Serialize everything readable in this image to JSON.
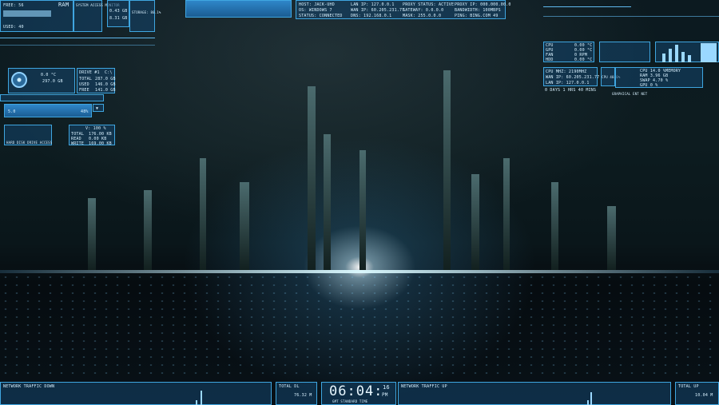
{
  "top_left": {
    "free_ram_label": "FREE: 56",
    "ram_label": "RAM",
    "used_label": "USED: 40",
    "panel2_title": "SYSTEM ACCESS MONITOR",
    "rows": [
      "0.43 GB",
      "8.31 GB"
    ],
    "storage_label": "STORAGE: 80.1%"
  },
  "top_center": {
    "col1": [
      "HOST: JACK-UHD",
      "OS: WINDOWS 7",
      "STATUS: CONNECTED"
    ],
    "col2": [
      "LAN IP: 127.0.0.1",
      "WAN IP: 60.205.231.77",
      "DNS: 192.168.0.1"
    ],
    "col3": [
      "PROXY STATUS: ACTIVE",
      "GATEWAY: 0.0.0.0",
      "MASK: 255.0.0.0"
    ],
    "col4": [
      "PROXY IP: 000.000.00.0",
      "BANDWIDTH: 100MBPS",
      "PING: BING.COM 49"
    ]
  },
  "drive": {
    "temp": "0.0 °C",
    "size": "297.0 GB",
    "drive_label": "DRIVE #1",
    "drive_letter": "C:\\",
    "total_label": "TOTAL",
    "total": "287.0 GB",
    "used_label": "USED",
    "used": "146.0 GB",
    "free_label": "FREE",
    "free": "141.0 GB",
    "volume_label": "5.0",
    "volume_pct": "48%",
    "hdd_label": "HARD DISK DRIVE ACCESS",
    "io_total_label": "TOTAL",
    "io_total": "176.00 KB",
    "io_read_label": "READ",
    "io_read": "0.00 KB",
    "io_write_label": "WRITE",
    "io_write": "169.00 KB",
    "vsel": "V: 100 %"
  },
  "top_right": {
    "cpu_rows": [
      "CPU",
      "GPU",
      "FAN",
      "HDD"
    ],
    "cpu_vals": [
      "0.00 °C",
      "0.00 °C",
      "0 RPM",
      "0.00 °C"
    ],
    "cpu_mhz": "CPU MHZ: 2190MHZ",
    "wan_ip": "WAN IP: 60.205.231.77",
    "lan_ip": "LAN IP: 127.0.0.1",
    "uptime": "0 DAYS 1 HRS 40 MINS",
    "cpu_pct": "CPU 40.0%",
    "memory_label": "MEMORY",
    "mem_vals": [
      "CPU 14.0 %",
      "RAM 3.96 GB",
      "SWAP 4.70 %",
      "GPU 0 %"
    ],
    "graph_label": "GRAPHICAL ENT NET"
  },
  "bottom": {
    "net_down_label": "NETWORK TRAFFIC DOWN",
    "total_dl_label": "TOTAL DL",
    "total_dl": "76.32 M",
    "clock_time": "06:04:",
    "clock_sec": "16",
    "clock_ampm": "PM",
    "clock_zone": "GMT STANDARD TIME",
    "net_up_label": "NETWORK TRAFFIC UP",
    "total_up_label": "TOTAL UP",
    "total_up": "10.04 M"
  },
  "colors": {
    "accent": "#3fa6e0",
    "panel": "#1b5d93",
    "text": "#d8f1ff"
  }
}
